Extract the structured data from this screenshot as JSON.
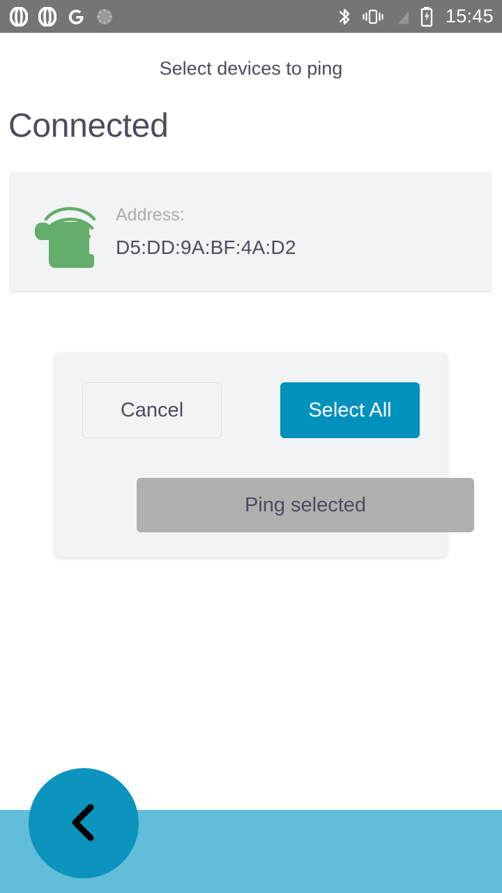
{
  "statusbar": {
    "left_icons": [
      {
        "name": "opera-icon",
        "glyph": "O"
      },
      {
        "name": "opera-beta-icon",
        "glyph": "O"
      },
      {
        "name": "google-icon",
        "glyph": "G"
      },
      {
        "name": "sync-progress-icon",
        "glyph": "◌"
      }
    ],
    "right_icons": [
      {
        "name": "bluetooth-icon"
      },
      {
        "name": "vibrate-icon"
      },
      {
        "name": "no-sim-icon"
      },
      {
        "name": "battery-charging-icon"
      }
    ],
    "time": "15:45",
    "background": "#757575",
    "foreground": "#ffffff"
  },
  "header": {
    "title": "Select devices to ping",
    "section_heading": "Connected",
    "text_color": "#4c4c5c"
  },
  "device": {
    "icon_name": "beacon-signal-icon",
    "icon_color": "#64ad6a",
    "address_label": "Address:",
    "address_value": "D5:DD:9A:BF:4A:D2",
    "card_background": "#f1f3f4"
  },
  "dialog": {
    "background": "#f1f3f4",
    "cancel_label": "Cancel",
    "select_all_label": "Select All",
    "ping_selected_label": "Ping selected",
    "accent_color": "#0091bc",
    "disabled_color": "#b0b0b1"
  },
  "bottom": {
    "bar_color": "#62bdda",
    "fab_color": "#0b94bd",
    "fab_icon_name": "chevron-left-icon",
    "fab_icon_color": "#000000"
  }
}
